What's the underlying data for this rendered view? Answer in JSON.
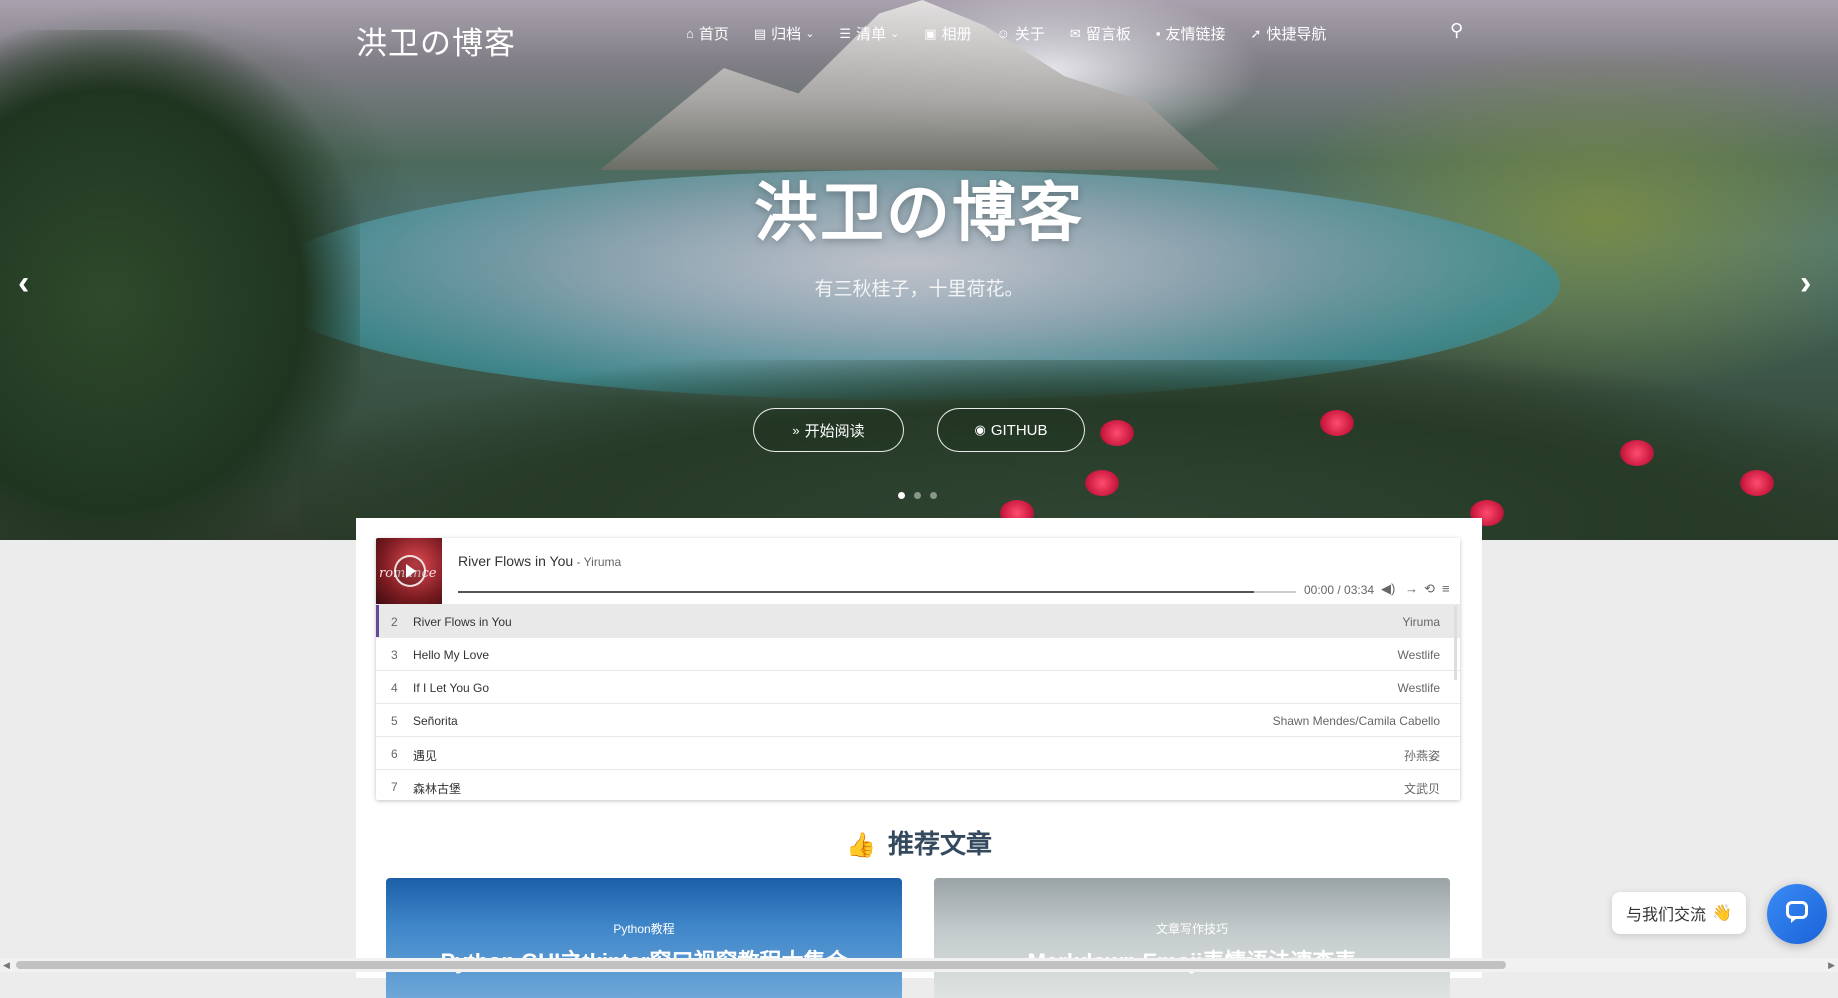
{
  "brand": "洪卫の博客",
  "nav": {
    "items": [
      {
        "label": "首页",
        "icon": "home-icon",
        "glyph": "⌂",
        "dropdown": false
      },
      {
        "label": "归档",
        "icon": "archive-icon",
        "glyph": "▤",
        "dropdown": true
      },
      {
        "label": "清单",
        "icon": "list-icon",
        "glyph": "☰",
        "dropdown": true
      },
      {
        "label": "相册",
        "icon": "image-icon",
        "glyph": "▣",
        "dropdown": false
      },
      {
        "label": "关于",
        "icon": "user-icon",
        "glyph": "☺",
        "dropdown": false
      },
      {
        "label": "留言板",
        "icon": "mail-icon",
        "glyph": "✉",
        "dropdown": false
      },
      {
        "label": "友情链接",
        "icon": "contact-icon",
        "glyph": "▪",
        "dropdown": false
      },
      {
        "label": "快捷导航",
        "icon": "rocket-icon",
        "glyph": "➚",
        "dropdown": false
      }
    ],
    "search_glyph": "⚲",
    "caret_glyph": "⌄"
  },
  "hero": {
    "title": "洪卫の博客",
    "subtitle": "有三秋桂子，十里荷花。",
    "start_button": "开始阅读",
    "start_glyph": "»",
    "github_button": "GITHUB",
    "github_glyph": "◉",
    "prev_glyph": "‹",
    "next_glyph": "›",
    "slide_count": 3,
    "active_slide": 0
  },
  "player": {
    "title": "River Flows in You",
    "artist": " - Yiruma",
    "cover_text": "romance",
    "time": "00:00 / 03:34",
    "progress": 0,
    "buffered": 0.95,
    "controls": {
      "volume": "◀)",
      "order": "→",
      "loop": "⟲",
      "menu": "≡"
    },
    "tracks": [
      {
        "num": "2",
        "name": "River Flows in You",
        "artist": "Yiruma"
      },
      {
        "num": "3",
        "name": "Hello My Love",
        "artist": "Westlife"
      },
      {
        "num": "4",
        "name": "If I Let You Go",
        "artist": "Westlife"
      },
      {
        "num": "5",
        "name": "Señorita",
        "artist": "Shawn Mendes/Camila Cabello"
      },
      {
        "num": "6",
        "name": "遇见",
        "artist": "孙燕姿"
      },
      {
        "num": "7",
        "name": "森林古堡",
        "artist": "文武贝"
      }
    ]
  },
  "recommend": {
    "title": "推荐文章",
    "thumb_glyph": "👍"
  },
  "articles": [
    {
      "category": "Python教程",
      "title": "Python GUI之tkinter窗口视窗教程大集合"
    },
    {
      "category": "文章写作技巧",
      "title": "Markdown Emoji表情语法速查表"
    }
  ],
  "chat": {
    "label": "与我们交流",
    "wave": "👋"
  },
  "colors": {
    "accent": "#66489b",
    "chat_blue": "#1a63d8",
    "heading": "#34495e"
  }
}
